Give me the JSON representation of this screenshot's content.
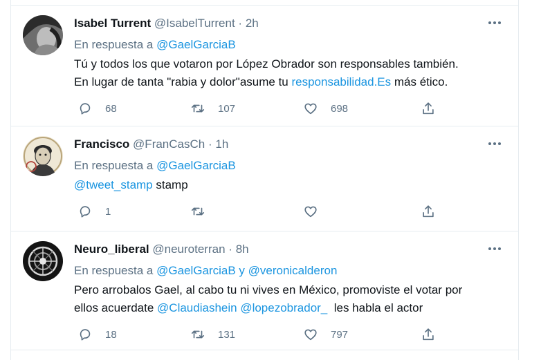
{
  "feed": {
    "tweets": [
      {
        "name": "Isabel Turrent",
        "handle": "@IsabelTurrent",
        "dot": "·",
        "time": "2h",
        "reply_prefix": "En respuesta a",
        "reply_mention_1": "@GaelGarciaB",
        "text_line_1": "Tú y todos los que votaron por López Obrador son responsables también.",
        "text_line_2_a": "En lugar de tanta \"rabia y dolor\"asume tu ",
        "text_line_2_link": "responsabilidad.Es",
        "text_line_2_b": " más ético.",
        "replies": "68",
        "retweets": "107",
        "likes": "698"
      },
      {
        "name": "Francisco",
        "handle": "@FranCasCh",
        "dot": "·",
        "time": "1h",
        "reply_prefix": "En respuesta a",
        "reply_mention_1": "@GaelGarciaB",
        "text_mention": "@tweet_stamp",
        "text_rest": " stamp",
        "replies": "1",
        "retweets": "",
        "likes": ""
      },
      {
        "name": "Neuro_liberal",
        "handle": "@neuroterran",
        "dot": "·",
        "time": "8h",
        "reply_prefix": "En respuesta a",
        "reply_mention_1": "@GaelGarciaB",
        "reply_joiner": " y ",
        "reply_mention_2": "@veronicalderon",
        "text_line_1": "Pero arrobalos Gael, al cabo tu ni vives en México, promoviste el votar por",
        "text_line_2_a": "ellos acuerdate ",
        "text_line_2_m1": "@Claudiashein",
        "text_line_2_sp": " ",
        "text_line_2_m2": "@lopezobrador_",
        "text_line_2_b": "  les habla el actor",
        "replies": "18",
        "retweets": "131",
        "likes": "797"
      }
    ]
  },
  "colors": {
    "text": "#0f1419",
    "secondary": "#5b7083",
    "link": "#1b95e0",
    "divider": "#e6ecf0"
  },
  "icons": [
    "reply-icon",
    "retweet-icon",
    "like-icon",
    "share-icon",
    "more-options-icon"
  ]
}
